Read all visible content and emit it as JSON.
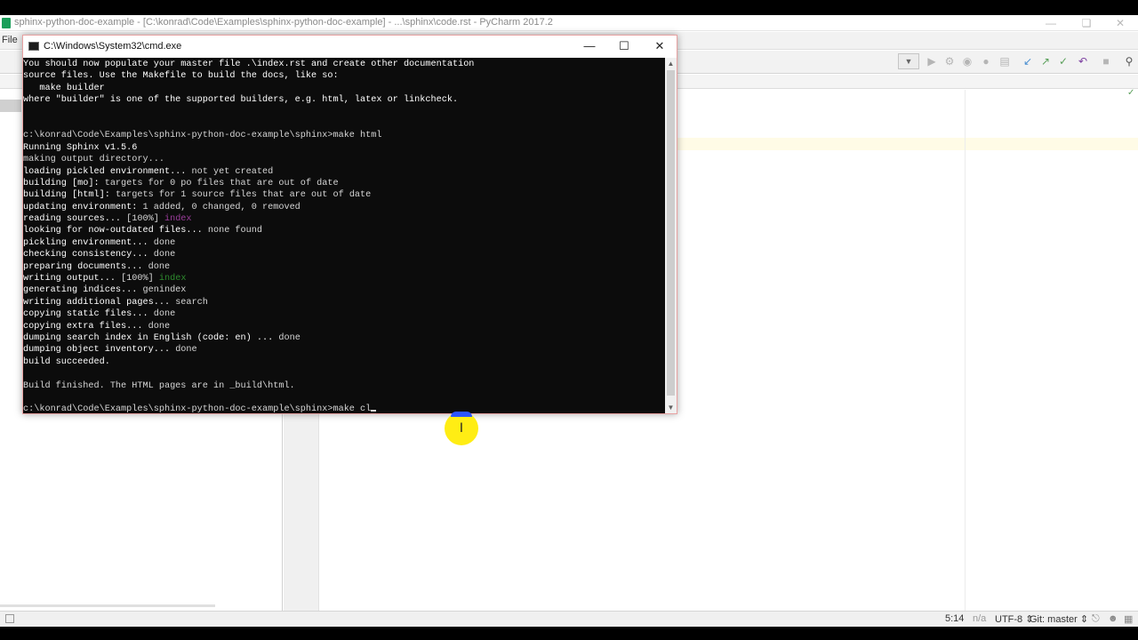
{
  "pycharm": {
    "window_title": "sphinx-python-doc-example - [C:\\konrad\\Code\\Examples\\sphinx-python-doc-example] - ...\\sphinx\\code.rst - PyCharm 2017.2",
    "menu_file": "File",
    "status": {
      "position": "5:14",
      "na": "n/a",
      "encoding": "UTF-8",
      "git": "Git: master"
    }
  },
  "cmd": {
    "title": "C:\\Windows\\System32\\cmd.exe",
    "lines": [
      "You should now populate your master file .\\index.rst and create other documentation",
      "source files. Use the Makefile to build the docs, like so:",
      "   make builder",
      "where \"builder\" is one of the supported builders, e.g. html, latex or linkcheck.",
      "",
      "",
      "c:\\konrad\\Code\\Examples\\sphinx-python-doc-example\\sphinx>make html",
      "Running Sphinx v1.5.6",
      "making output directory...",
      "loading pickled environment... not yet created",
      "building [mo]: targets for 0 po files that are out of date",
      "building [html]: targets for 1 source files that are out of date",
      "updating environment: 1 added, 0 changed, 0 removed",
      "reading sources... [100%] index",
      "looking for now-outdated files... none found",
      "pickling environment... done",
      "checking consistency... done",
      "preparing documents... done",
      "writing output... [100%] index",
      "generating indices... genindex",
      "writing additional pages... search",
      "copying static files... done",
      "copying extra files... done",
      "dumping search index in English (code: en) ... done",
      "dumping object inventory... done",
      "build succeeded.",
      "",
      "Build finished. The HTML pages are in _build\\html.",
      "",
      "c:\\konrad\\Code\\Examples\\sphinx-python-doc-example\\sphinx>make cl"
    ]
  },
  "colors": {
    "console_bg": "#0c0c0c",
    "console_text": "#d6d6d6",
    "index_purple": "#9b3d9b",
    "index_green": "#2e8b2e",
    "cursor_yellow": "#ffec00",
    "cursor_blue": "#2c55ff"
  },
  "icons": [
    "pycharm-app-icon",
    "cmd-app-icon",
    "run-icon",
    "debug-icon",
    "vcs-update-icon",
    "vcs-commit-icon",
    "undo-icon",
    "stop-icon",
    "search-icon",
    "text-cursor-icon"
  ]
}
